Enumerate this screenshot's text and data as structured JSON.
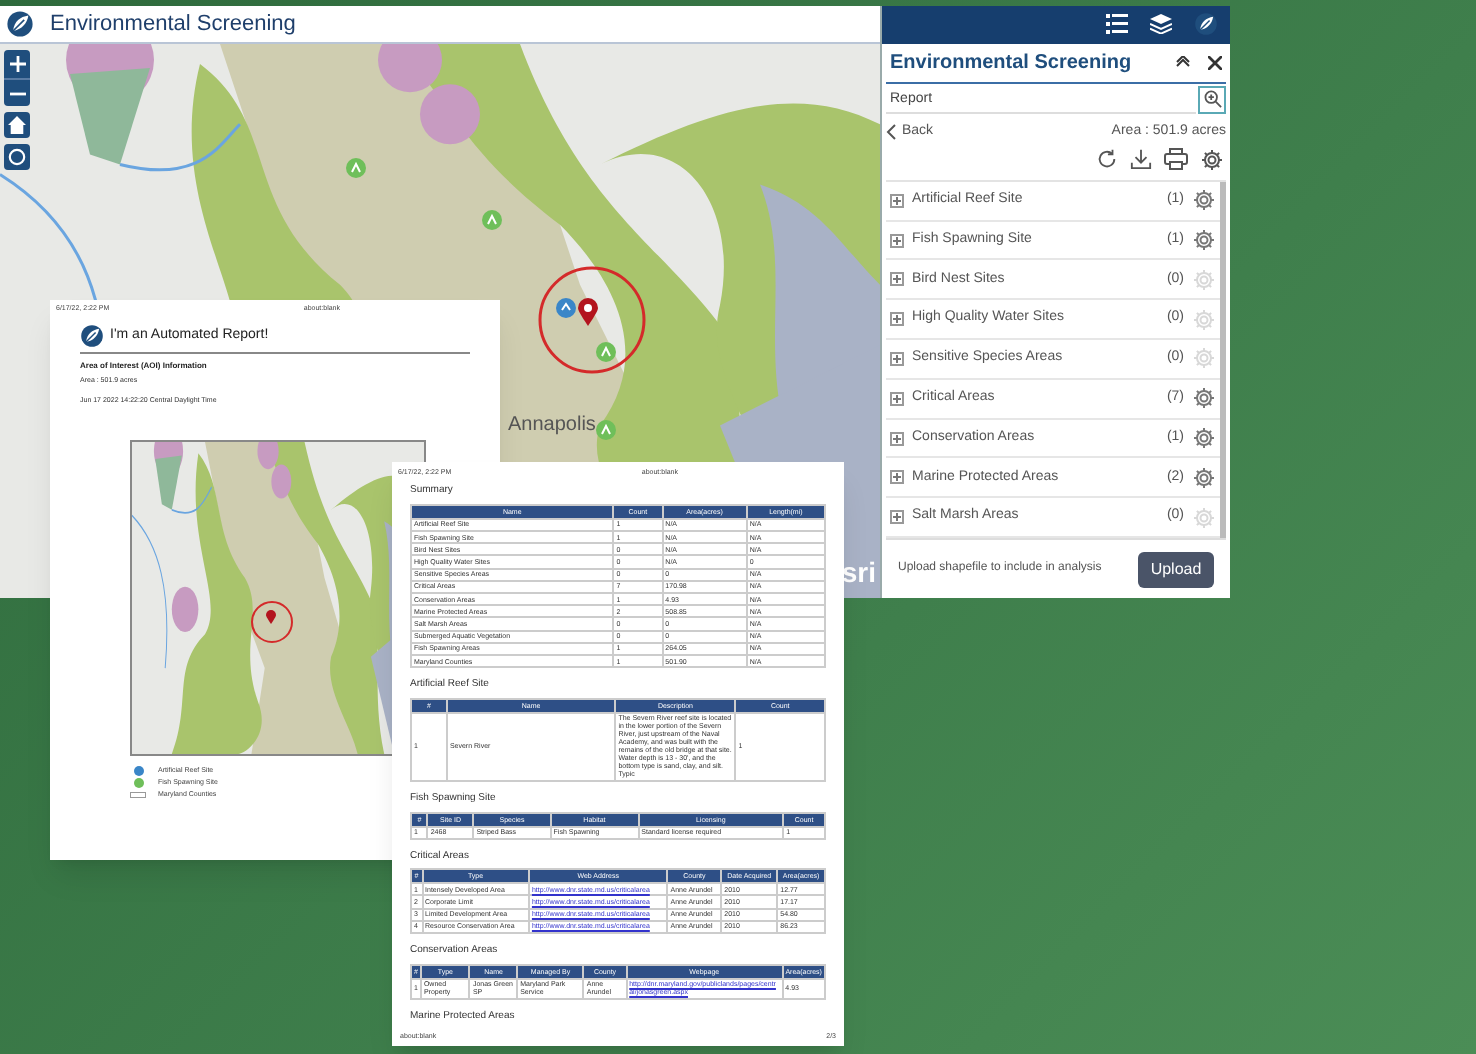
{
  "app": {
    "title": "Environmental Screening",
    "map_labels": [
      "Annapolis",
      "sri"
    ]
  },
  "panel": {
    "title": "Environmental Screening",
    "search": {
      "value": "Report"
    },
    "back": "Back",
    "area": "Area : 501.9 acres",
    "layers": [
      {
        "name": "Artificial Reef Site",
        "count": "(1)",
        "gear_enabled": true
      },
      {
        "name": "Fish Spawning Site",
        "count": "(1)",
        "gear_enabled": true
      },
      {
        "name": "Bird Nest Sites",
        "count": "(0)",
        "gear_enabled": false
      },
      {
        "name": "High Quality Water Sites",
        "count": "(0)",
        "gear_enabled": false
      },
      {
        "name": "Sensitive Species Areas",
        "count": "(0)",
        "gear_enabled": false
      },
      {
        "name": "Critical Areas",
        "count": "(7)",
        "gear_enabled": true
      },
      {
        "name": "Conservation Areas",
        "count": "(1)",
        "gear_enabled": true
      },
      {
        "name": "Marine Protected Areas",
        "count": "(2)",
        "gear_enabled": true
      },
      {
        "name": "Salt Marsh Areas",
        "count": "(0)",
        "gear_enabled": false
      }
    ],
    "upload_hint": "Upload shapefile to include in analysis",
    "upload_button": "Upload"
  },
  "report_page_1": {
    "timestamp": "6/17/22, 2:22 PM",
    "url": "about:blank",
    "heading": "I'm an Automated Report!",
    "section": "Area of Interest (AOI) Information",
    "area": "Area : 501.9 acres",
    "date": "Jun 17 2022 14:22:20 Central Daylight Time",
    "legend": [
      {
        "label": "Artificial Reef Site",
        "kind": "reef"
      },
      {
        "label": "Fish Spawning Site",
        "kind": "spawn"
      },
      {
        "label": "Maryland Counties",
        "kind": "county"
      }
    ]
  },
  "report_page_2": {
    "timestamp": "6/17/22, 2:22 PM",
    "url": "about:blank",
    "footer_url": "about:blank",
    "page": "2/3",
    "sections": [
      {
        "title": "Summary",
        "columns": [
          "Name",
          "Count",
          "Area(acres)",
          "Length(mi)"
        ],
        "rows": [
          [
            "Artificial Reef Site",
            "1",
            "N/A",
            "N/A"
          ],
          [
            "Fish Spawning Site",
            "1",
            "N/A",
            "N/A"
          ],
          [
            "Bird Nest Sites",
            "0",
            "N/A",
            "N/A"
          ],
          [
            "High Quality Water Sites",
            "0",
            "N/A",
            "0"
          ],
          [
            "Sensitive Species Areas",
            "0",
            "0",
            "N/A"
          ],
          [
            "Critical Areas",
            "7",
            "170.98",
            "N/A"
          ],
          [
            "Conservation Areas",
            "1",
            "4.93",
            "N/A"
          ],
          [
            "Marine Protected Areas",
            "2",
            "508.85",
            "N/A"
          ],
          [
            "Salt Marsh Areas",
            "0",
            "0",
            "N/A"
          ],
          [
            "Submerged Aquatic Vegetation",
            "0",
            "0",
            "N/A"
          ],
          [
            "Fish Spawning Areas",
            "1",
            "264.05",
            "N/A"
          ],
          [
            "Maryland Counties",
            "1",
            "501.90",
            "N/A"
          ]
        ]
      },
      {
        "title": "Artificial Reef Site",
        "columns": [
          "#",
          "Name",
          "Description",
          "Count"
        ],
        "rows": [
          [
            "1",
            "Severn River",
            "The Severn River reef site is located in the lower portion of the Severn River, just upstream of the Naval Academy, and was built with the remains of the old bridge at that site. Water depth is 13 - 30', and the bottom type is sand, clay, and silt. Typic",
            "1"
          ]
        ]
      },
      {
        "title": "Fish Spawning Site",
        "columns": [
          "#",
          "Site ID",
          "Species",
          "Habitat",
          "Licensing",
          "Count"
        ],
        "rows": [
          [
            "1",
            "2468",
            "Striped Bass",
            "Fish Spawning",
            "Standard license required",
            "1"
          ]
        ]
      },
      {
        "title": "Critical Areas",
        "columns": [
          "#",
          "Type",
          "Web Address",
          "County",
          "Date Acquired",
          "Area(acres)"
        ],
        "rows": [
          [
            "1",
            "Intensely Developed Area",
            {
              "text": "http://www.dnr.state.md.us/criticalarea",
              "link": true
            },
            "Anne Arundel",
            "2010",
            "12.77"
          ],
          [
            "2",
            "Corporate Limit",
            {
              "text": "http://www.dnr.state.md.us/criticalarea",
              "link": true
            },
            "Anne Arundel",
            "2010",
            "17.17"
          ],
          [
            "3",
            "Limited Development Area",
            {
              "text": "http://www.dnr.state.md.us/criticalarea",
              "link": true
            },
            "Anne Arundel",
            "2010",
            "54.80"
          ],
          [
            "4",
            "Resource Conservation Area",
            {
              "text": "http://www.dnr.state.md.us/criticalarea",
              "link": true
            },
            "Anne Arundel",
            "2010",
            "86.23"
          ]
        ]
      },
      {
        "title": "Conservation Areas",
        "columns": [
          "#",
          "Type",
          "Name",
          "Managed By",
          "County",
          "Webpage",
          "Area(acres)"
        ],
        "rows": [
          [
            "1",
            "Owned Property",
            "Jonas Green SP",
            "Maryland Park Service",
            "Anne Arundel",
            {
              "text": "http://dnr.maryland.gov/publiclands/pages/central/jonasgreen.aspx",
              "link": true
            },
            "4.93"
          ]
        ]
      },
      {
        "title": "Marine Protected Areas"
      }
    ]
  }
}
